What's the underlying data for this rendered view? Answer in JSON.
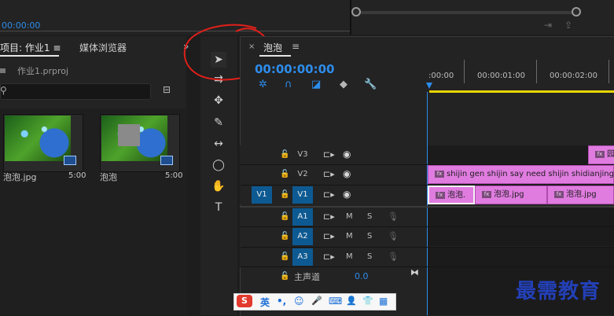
{
  "top": {
    "timecode": "00:00:00"
  },
  "project_panel": {
    "tab_project": "项目: 作业1",
    "tab_menu_icon": "≡",
    "tab_media": "媒体浏览器",
    "file_name": "作业1.prproj",
    "items": [
      {
        "name": "泡泡.jpg",
        "duration": "5:00"
      },
      {
        "name": "泡泡",
        "duration": "5:00"
      }
    ]
  },
  "sequence": {
    "close_icon": "×",
    "title": "泡泡",
    "menu_icon": "≡",
    "timecode": "00:00:00:00",
    "ruler_labels": [
      ":00:00",
      "00:00:01:00",
      "00:00:02:00"
    ],
    "tracks": {
      "video": [
        {
          "label": "V3"
        },
        {
          "label": "V2"
        },
        {
          "label": "V1",
          "source": "V1"
        }
      ],
      "audio": [
        {
          "label": "A1",
          "m": "M",
          "s": "S"
        },
        {
          "label": "A2",
          "m": "M",
          "s": "S"
        },
        {
          "label": "A3",
          "m": "M",
          "s": "S"
        }
      ]
    },
    "clips": {
      "fx": "fx",
      "v3_clip": "园",
      "v2_clip": "shijin gen shijin say need shijin shidianjing",
      "v1_clips": [
        "泡泡.",
        "泡泡.jpg",
        "泡泡.jpg"
      ]
    },
    "master": {
      "label": "主声道",
      "value": "0.0"
    }
  },
  "ime": {
    "logo": "S",
    "items": [
      "英",
      "•,",
      "☺",
      "🎤",
      "⌨",
      "👤",
      "👕",
      "▦"
    ]
  },
  "watermark": "最需教育",
  "colors": {
    "accent_blue": "#2d8ceb",
    "clip_pink": "#e07ce0",
    "annotation_red": "#e0201a",
    "work_area_yellow": "#e8d400"
  }
}
